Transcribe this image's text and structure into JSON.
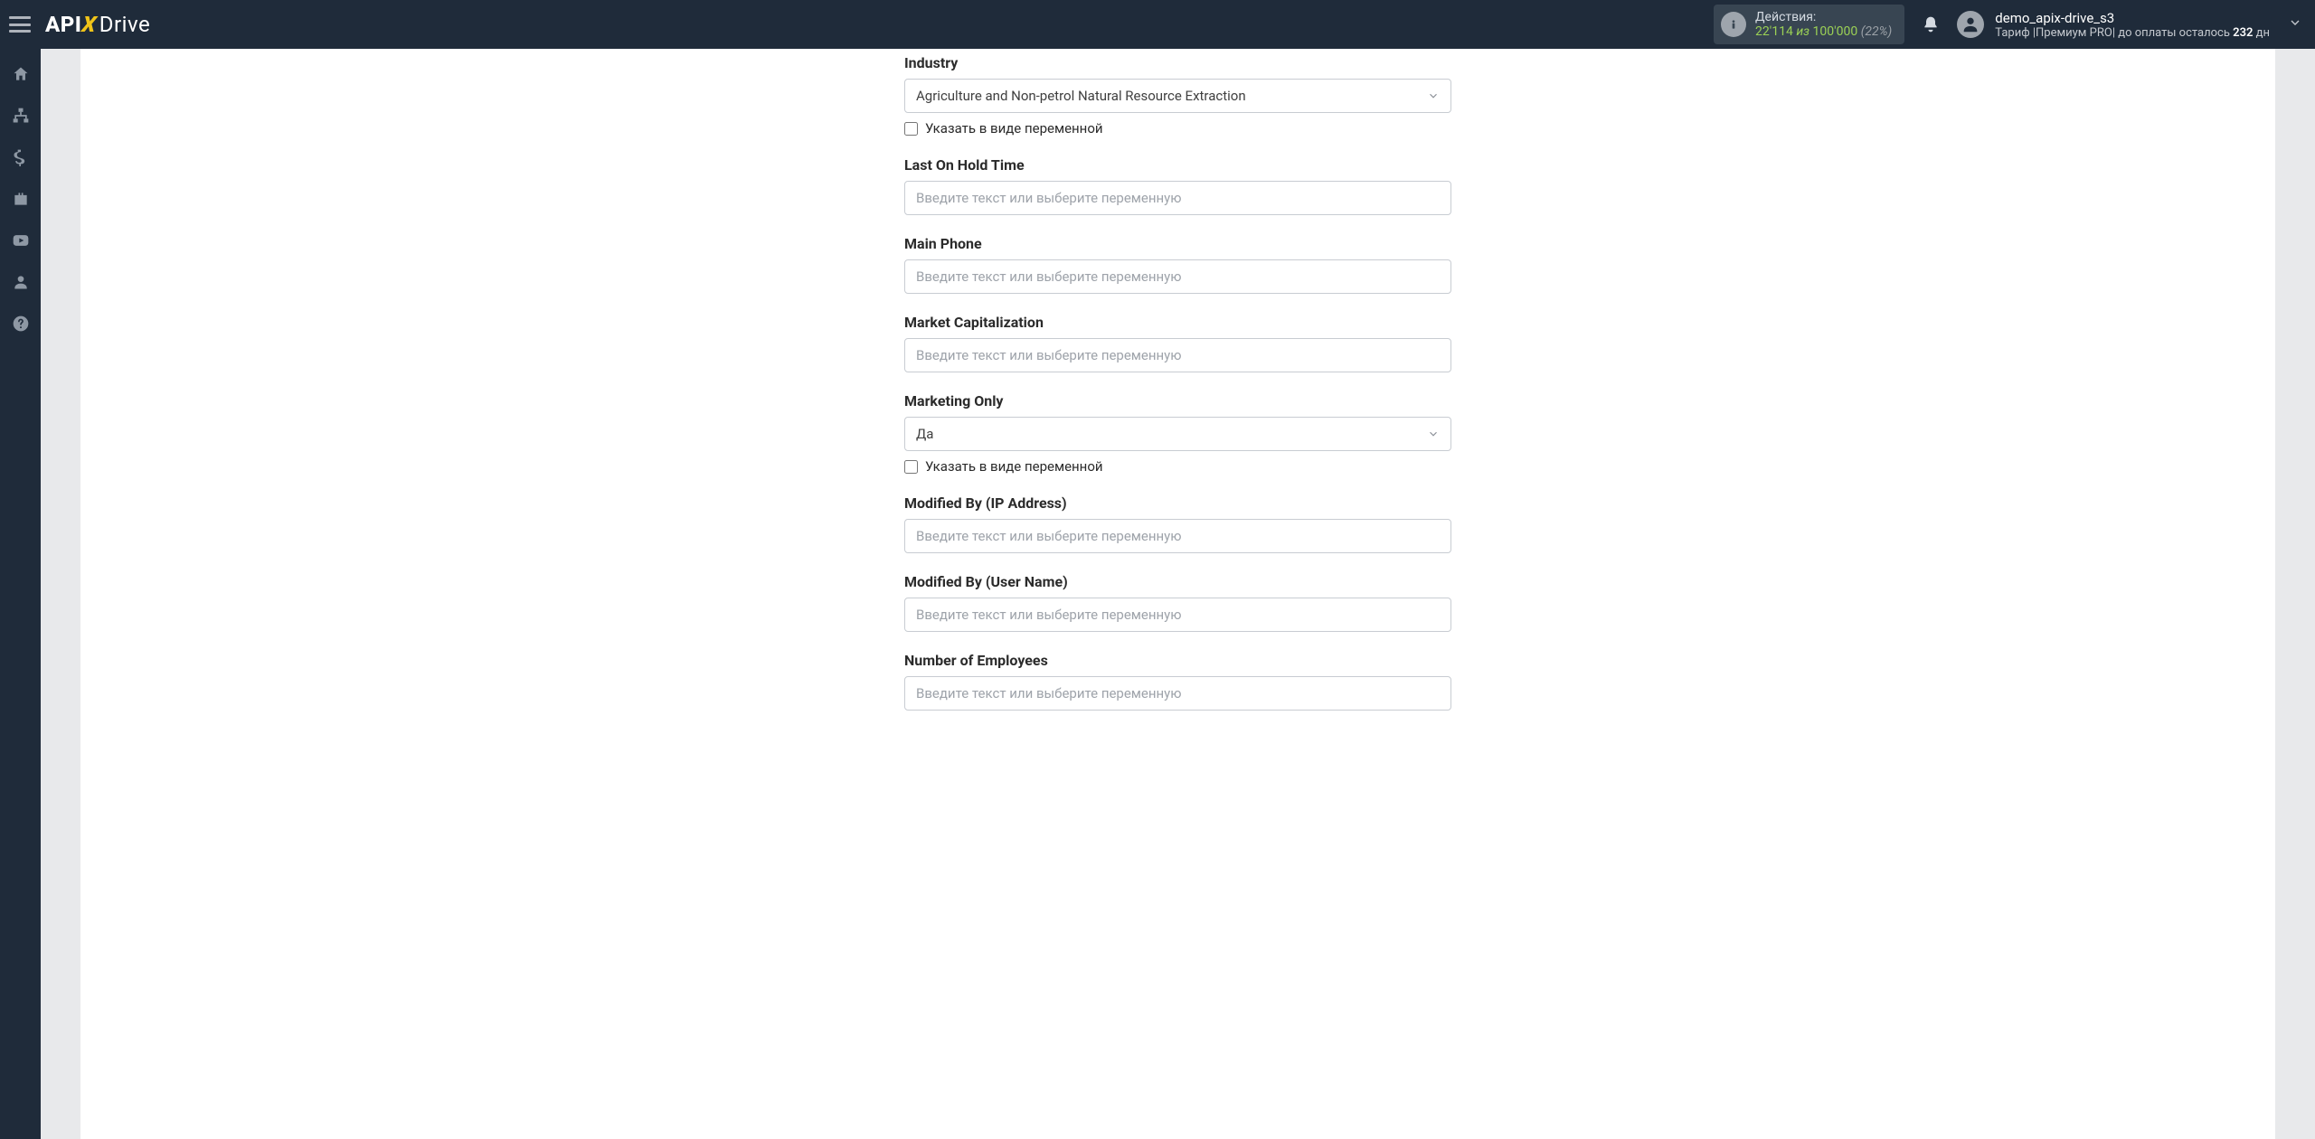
{
  "header": {
    "logo": {
      "api": "API",
      "x": "X",
      "drive": "Drive"
    },
    "actions": {
      "label": "Действия:",
      "count": "22'114",
      "of_word": "из",
      "total": "100'000",
      "percent": "(22%)"
    },
    "user": {
      "name": "demo_apix-drive_s3",
      "tariff_prefix": "Тариф ",
      "tariff_plan": "|Премиум PRO|",
      "pay_prefix": " до оплаты осталось ",
      "days": "232",
      "days_suffix": " дн"
    }
  },
  "form": {
    "placeholder": "Введите текст или выберите переменную",
    "variable_checkbox": "Указать в виде переменной",
    "fields": {
      "industry": {
        "label": "Industry",
        "value": "Agriculture and Non-petrol Natural Resource Extraction"
      },
      "last_on_hold_time": {
        "label": "Last On Hold Time"
      },
      "main_phone": {
        "label": "Main Phone"
      },
      "market_capitalization": {
        "label": "Market Capitalization"
      },
      "marketing_only": {
        "label": "Marketing Only",
        "value": "Да"
      },
      "modified_by_ip": {
        "label": "Modified By (IP Address)"
      },
      "modified_by_user": {
        "label": "Modified By (User Name)"
      },
      "number_of_employees": {
        "label": "Number of Employees"
      }
    }
  }
}
